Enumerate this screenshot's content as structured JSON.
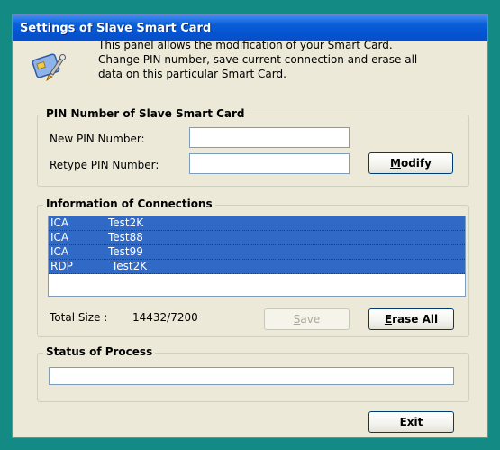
{
  "window": {
    "title": "Settings of Slave Smart Card"
  },
  "intro": {
    "line1": "This panel allows the modification of your Smart Card.",
    "line2": "Change PIN number, save current connection and erase all",
    "line3": "data on this particular Smart Card."
  },
  "icon": "smartcard-settings-icon",
  "pin": {
    "group_title": "PIN Number of Slave Smart Card",
    "new_label": "New PIN Number:",
    "new_value": "",
    "retype_label": "Retype PIN Number:",
    "retype_value": "",
    "modify": {
      "prefix": "",
      "mnemonic": "M",
      "suffix": "odify"
    }
  },
  "connections": {
    "group_title": "Information of Connections",
    "rows": [
      {
        "type": "ICA",
        "name": "Test2K"
      },
      {
        "type": "ICA",
        "name": "Test88"
      },
      {
        "type": "ICA",
        "name": "Test99"
      },
      {
        "type": "RDP",
        "name": "Test2K"
      }
    ],
    "total_label": "Total Size :",
    "total_value": "14432/7200",
    "save": {
      "prefix": "",
      "mnemonic": "S",
      "suffix": "ave",
      "enabled": false
    },
    "erase": {
      "prefix": "",
      "mnemonic": "E",
      "suffix": "rase All"
    }
  },
  "status": {
    "group_title": "Status of Process",
    "progress": 0
  },
  "exit": {
    "prefix": "",
    "mnemonic": "E",
    "suffix": "xit"
  },
  "colors": {
    "desktop": "#138a83",
    "titlebar": "#0553d0",
    "window_bg": "#ece9d8",
    "selection": "#3169c6"
  }
}
